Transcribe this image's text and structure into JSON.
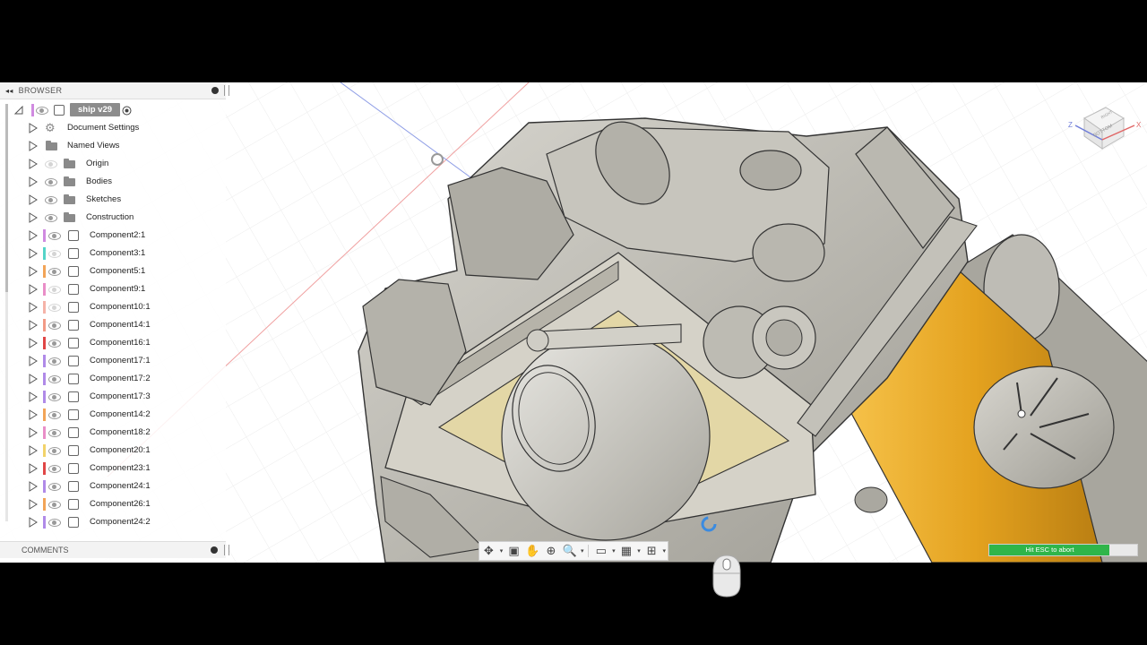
{
  "browser": {
    "header": "BROWSER",
    "root": "ship v29",
    "items": [
      {
        "label": "Document Settings",
        "icon": "gear-icon"
      },
      {
        "label": "Named Views",
        "icon": "folder-icon"
      },
      {
        "label": "Origin",
        "icon": "folder-icon",
        "visible": false
      },
      {
        "label": "Bodies",
        "icon": "folder-icon",
        "visible": true
      },
      {
        "label": "Sketches",
        "icon": "folder-icon",
        "visible": true
      },
      {
        "label": "Construction",
        "icon": "folder-icon",
        "visible": true
      }
    ],
    "components": [
      {
        "label": "Component2:1",
        "color": "#d08ae0",
        "visible": true
      },
      {
        "label": "Component3:1",
        "color": "#55d4c8",
        "visible": false
      },
      {
        "label": "Component5:1",
        "color": "#f2a457",
        "visible": true
      },
      {
        "label": "Component9:1",
        "color": "#e98ec8",
        "visible": false
      },
      {
        "label": "Component10:1",
        "color": "#f5b3a8",
        "visible": false
      },
      {
        "label": "Component14:1",
        "color": "#f29a86",
        "visible": true
      },
      {
        "label": "Component16:1",
        "color": "#e04646",
        "visible": true
      },
      {
        "label": "Component17:1",
        "color": "#b08ae8",
        "visible": true
      },
      {
        "label": "Component17:2",
        "color": "#b08ae8",
        "visible": true
      },
      {
        "label": "Component17:3",
        "color": "#b08ae8",
        "visible": true
      },
      {
        "label": "Component14:2",
        "color": "#f2a457",
        "visible": true
      },
      {
        "label": "Component18:2",
        "color": "#e98ec8",
        "visible": true
      },
      {
        "label": "Component20:1",
        "color": "#f2d36a",
        "visible": true
      },
      {
        "label": "Component23:1",
        "color": "#e04646",
        "visible": true
      },
      {
        "label": "Component24:1",
        "color": "#b08ae8",
        "visible": true
      },
      {
        "label": "Component26:1",
        "color": "#f2a457",
        "visible": true
      },
      {
        "label": "Component24:2",
        "color": "#b08ae8",
        "visible": true
      }
    ]
  },
  "comments": {
    "header": "COMMENTS"
  },
  "toolbar": {
    "buttons": [
      "orbit-icon",
      "look-at-icon",
      "pan-icon",
      "zoom-icon",
      "fit-icon",
      "display-settings-icon",
      "grid-icon",
      "viewports-icon"
    ]
  },
  "progress": {
    "text": "Hit ESC to abort",
    "fraction": 0.81
  },
  "viewcube": {
    "face_label": "BOTTOM",
    "top_label": "RIGHT",
    "axis_x": "X",
    "axis_z": "Z"
  },
  "colors": {
    "accent_progress": "#2fb54a",
    "component_highlight": "#e9a52a",
    "model_gray": "#b8b6ae",
    "tan_face": "#e0d5a8"
  }
}
